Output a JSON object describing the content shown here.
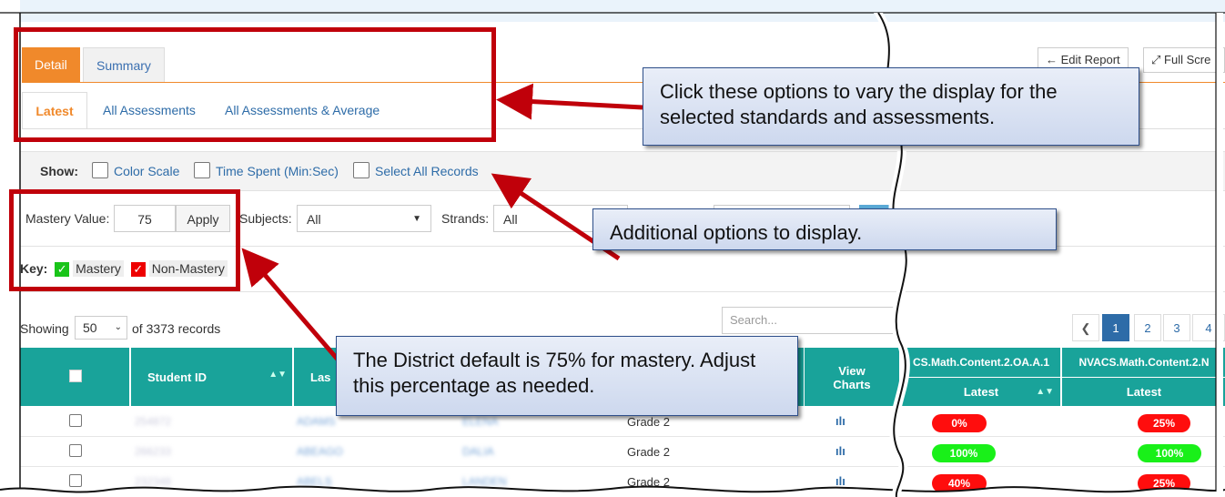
{
  "tabs": {
    "detail": "Detail",
    "summary": "Summary"
  },
  "subtabs": {
    "latest": "Latest",
    "all": "All Assessments",
    "avg": "All Assessments & Average"
  },
  "toolbar": {
    "edit": "Edit Report",
    "full": "Full Scre"
  },
  "show": {
    "label": "Show:",
    "color_scale": "Color Scale",
    "time_spent": "Time Spent (Min:Sec)",
    "select_all": "Select All Records"
  },
  "mastery": {
    "label": "Mastery Value:",
    "value": "75",
    "apply": "Apply"
  },
  "filters": {
    "subjects_label": "Subjects:",
    "subjects_value": "All",
    "strands_label": "Strands:",
    "strands_value": "All"
  },
  "key": {
    "label": "Key:",
    "mastery": "Mastery",
    "non_mastery": "Non-Mastery"
  },
  "listing": {
    "showing": "Showing",
    "per_page": "50",
    "of_records": "of 3373 records",
    "search_placeholder": "Search..."
  },
  "pagination": [
    "1",
    "2",
    "3",
    "4"
  ],
  "table": {
    "headers": {
      "student_id": "Student ID",
      "last": "Las",
      "view_charts": "View Charts",
      "std1": "CS.Math.Content.2.OA.A.1",
      "std2": "NVACS.Math.Content.2.N",
      "latest": "Latest"
    },
    "rows": [
      {
        "id": "254872",
        "last": "ADAMS",
        "first": "ELENA",
        "grade": "Grade 2",
        "s1": "0%",
        "s1_status": "non-mastery",
        "s2": "25%",
        "s2_status": "non-mastery"
      },
      {
        "id": "266233",
        "last": "ABEAGO",
        "first": "DALIA",
        "grade": "Grade 2",
        "s1": "100%",
        "s1_status": "mastery",
        "s2": "100%",
        "s2_status": "mastery"
      },
      {
        "id": "232348",
        "last": "ABELS",
        "first": "LANDEN",
        "grade": "Grade 2",
        "s1": "40%",
        "s1_status": "non-mastery",
        "s2": "25%",
        "s2_status": "non-mastery"
      }
    ]
  },
  "callouts": {
    "c1": "Click these options to vary the display for the selected standards and assessments.",
    "c2": "Additional options to display.",
    "c3": "The District default is 75% for mastery. Adjust this percentage as needed."
  },
  "colors": {
    "accent": "#f0892b",
    "teal": "#19a39a",
    "annotation_red": "#c0000a",
    "mastery": "#19f019",
    "non_mastery": "#ff0d0d"
  }
}
